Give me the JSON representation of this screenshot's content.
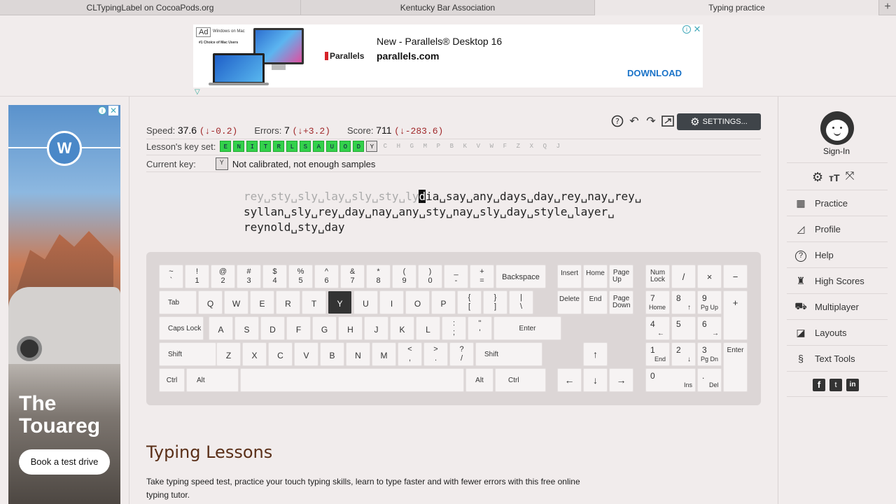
{
  "tabs": [
    {
      "label": "CLTypingLabel on CocoaPods.org",
      "active": false
    },
    {
      "label": "Kentucky Bar Association",
      "active": false
    },
    {
      "label": "Typing practice",
      "active": true
    }
  ],
  "new_tab": "+",
  "top_ad": {
    "badge": "Ad",
    "title": "New - Parallels® Desktop 16",
    "domain": "parallels.com",
    "brand": "Parallels",
    "cta": "DOWNLOAD",
    "small_text": "Windows on Mac",
    "small_text2": "#1 Choice of Mac Users"
  },
  "left_ad": {
    "headline_1": "The",
    "headline_2": "Touareg",
    "cta": "Book a test drive",
    "brand_icon": "vw-logo-icon"
  },
  "stats": {
    "speed_label": "Speed:",
    "speed_value": "37.6",
    "speed_delta": "(↓-0.2)",
    "errors_label": "Errors:",
    "errors_value": "7",
    "errors_delta": "(↓+3.2)",
    "score_label": "Score:",
    "score_value": "711",
    "score_delta": "(↓-283.6)"
  },
  "settings_label": "SETTINGS...",
  "keyset_label": "Lesson's key set:",
  "keyset_active": [
    "E",
    "N",
    "I",
    "T",
    "R",
    "L",
    "S",
    "A",
    "U",
    "O",
    "D"
  ],
  "keyset_current": "Y",
  "keyset_inactive": [
    "C",
    "H",
    "G",
    "M",
    "P",
    "B",
    "K",
    "V",
    "W",
    "F",
    "Z",
    "X",
    "Q",
    "J"
  ],
  "current_key_label": "Current key:",
  "current_key": "Y",
  "current_key_note": "Not calibrated, not enough samples",
  "text": {
    "done": "rey␣sty␣sly␣lay␣sly␣sty␣ly",
    "cursor": "d",
    "line1_rest": "ia␣say␣any␣days␣day␣rey␣nay␣rey␣",
    "line2": "syllan␣sly␣rey␣day␣nay␣any␣sty␣nay␣sly␣day␣style␣layer␣",
    "line3": "reynold␣sty␣day"
  },
  "keyboard": {
    "row1": [
      [
        "~",
        "`"
      ],
      [
        "!",
        "1"
      ],
      [
        "@",
        "2"
      ],
      [
        "#",
        "3"
      ],
      [
        "$",
        "4"
      ],
      [
        "%",
        "5"
      ],
      [
        "^",
        "6"
      ],
      [
        "&",
        "7"
      ],
      [
        "*",
        "8"
      ],
      [
        "(",
        "9"
      ],
      [
        ")",
        "0"
      ],
      [
        "_",
        "-"
      ],
      [
        "+",
        "="
      ]
    ],
    "backspace": "Backspace",
    "tab": "Tab",
    "row2": [
      "Q",
      "W",
      "E",
      "R",
      "T",
      "Y",
      "U",
      "I",
      "O",
      "P"
    ],
    "brackets": [
      [
        "{",
        "["
      ],
      [
        "}",
        "]"
      ],
      [
        "|",
        "\\"
      ]
    ],
    "caps": "Caps Lock",
    "row3": [
      "A",
      "S",
      "D",
      "F",
      "G",
      "H",
      "J",
      "K",
      "L"
    ],
    "semi": [
      ":",
      ";"
    ],
    "quote": [
      "\"",
      "'"
    ],
    "enter": "Enter",
    "shift": "Shift",
    "row4": [
      "Z",
      "X",
      "C",
      "V",
      "B",
      "N",
      "M"
    ],
    "comma": [
      "<",
      ","
    ],
    "period": [
      ">",
      "."
    ],
    "slash": [
      "?",
      "/"
    ],
    "ctrl": "Ctrl",
    "alt": "Alt",
    "highlight": "Y",
    "nav": {
      "insert": "Insert",
      "home": "Home",
      "pgup": "Page Up",
      "delete": "Delete",
      "end": "End",
      "pgdn": "Page Down"
    },
    "arrows": {
      "up": "↑",
      "left": "←",
      "down": "↓",
      "right": "→"
    },
    "numpad": {
      "numlock": "Num Lock",
      "div": "/",
      "mul": "×",
      "minus": "−",
      "plus": "+",
      "enter": "Enter",
      "n7": "7",
      "n7s": "Home",
      "n8": "8",
      "n8s": "↑",
      "n9": "9",
      "n9s": "Pg Up",
      "n4": "4",
      "n4s": "←",
      "n5": "5",
      "n6": "6",
      "n6s": "→",
      "n1": "1",
      "n1s": "End",
      "n2": "2",
      "n2s": "↓",
      "n3": "3",
      "n3s": "Pg Dn",
      "n0": "0",
      "n0s": "Ins",
      "dot": ".",
      "dots": "Del"
    }
  },
  "sidebar": {
    "signin": "Sign-In",
    "items": [
      {
        "label": "Practice",
        "icon": "keyboard-icon"
      },
      {
        "label": "Profile",
        "icon": "chart-icon"
      },
      {
        "label": "Help",
        "icon": "help-icon"
      },
      {
        "label": "High Scores",
        "icon": "trophy-icon"
      },
      {
        "label": "Multiplayer",
        "icon": "car-icon"
      },
      {
        "label": "Layouts",
        "icon": "layouts-icon"
      },
      {
        "label": "Text Tools",
        "icon": "section-icon"
      }
    ]
  },
  "lessons": {
    "heading": "Typing Lessons",
    "body": "Take typing speed test, practice your touch typing skills, learn to type faster and with fewer errors with this free online typing tutor."
  }
}
